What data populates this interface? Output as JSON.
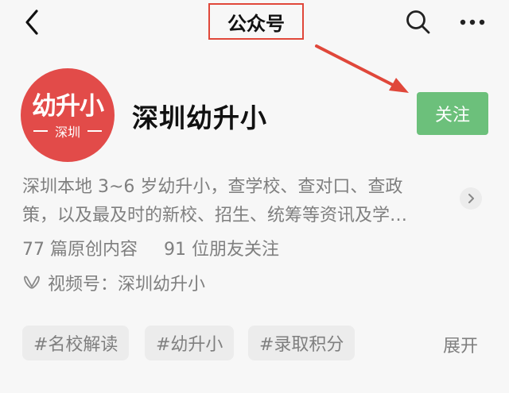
{
  "header": {
    "title": "公众号"
  },
  "icons": {
    "back": "back-icon",
    "search": "search-icon",
    "more": "more-icon"
  },
  "account": {
    "logo_main": "幼升小",
    "logo_sub": "深圳",
    "name": "深圳幼升小",
    "follow_label": "关注"
  },
  "description": {
    "line1": "深圳本地 3~6 岁幼升小，查学校、查对口、查政",
    "line2": "策，以及最及时的新校、招生、统筹等资讯及学…"
  },
  "stats": {
    "original": "77 篇原创内容",
    "friends": "91 位朋友关注"
  },
  "channel": {
    "label": "视频号：深圳幼升小"
  },
  "tags": [
    "#名校解读",
    "#幼升小",
    "#录取积分"
  ],
  "expand_label": "展开",
  "colors": {
    "follow": "#6cc07b",
    "avatar": "#e24b49",
    "annotation": "#e0473a"
  }
}
